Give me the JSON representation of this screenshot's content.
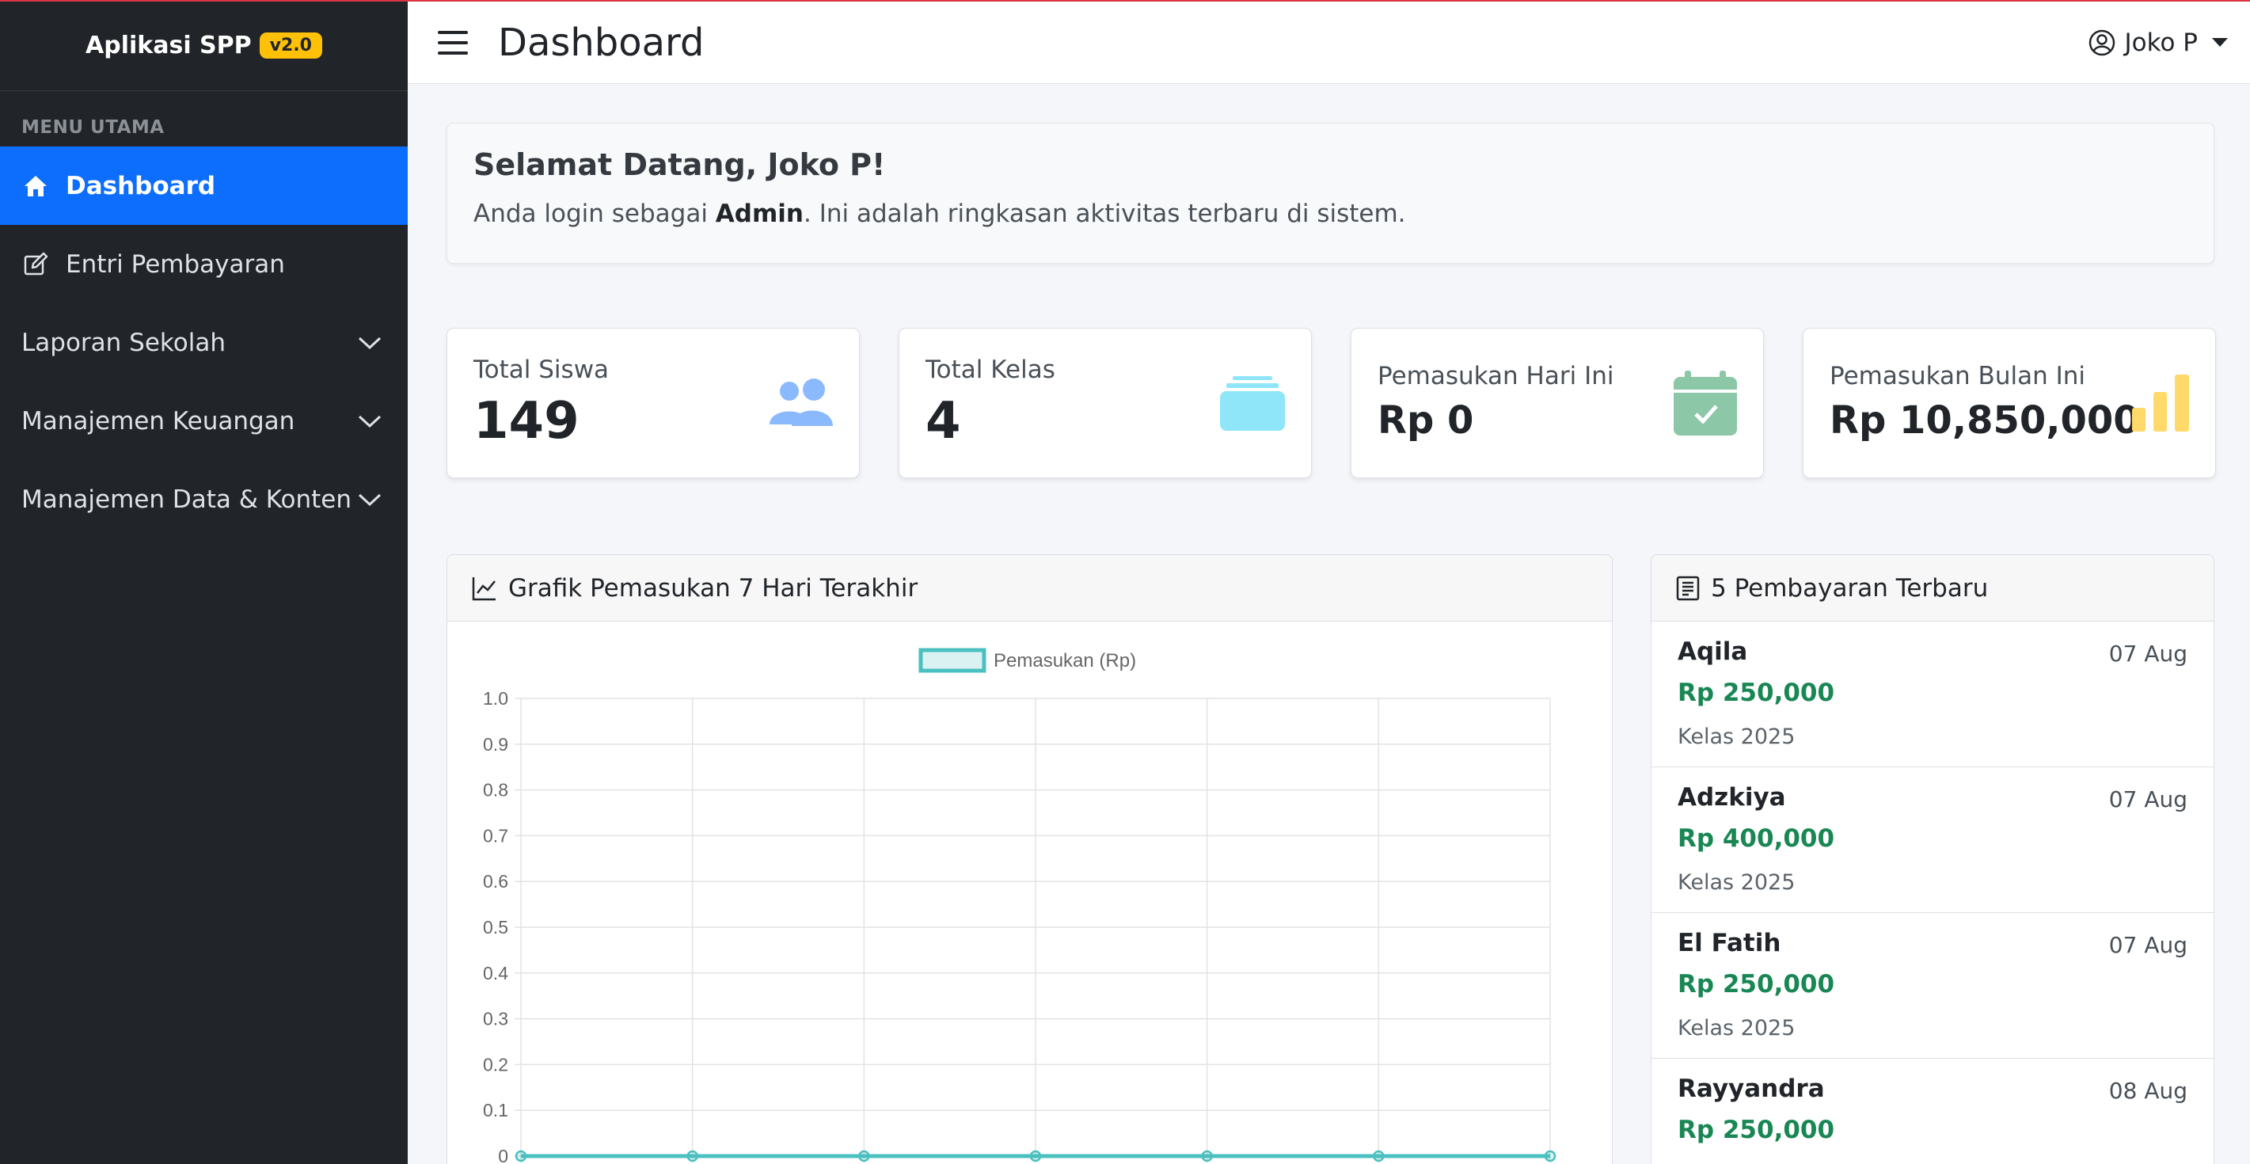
{
  "app": {
    "title": "Aplikasi SPP",
    "version": "v2.0"
  },
  "colors": {
    "primary": "#0d6efd",
    "sidebar": "#212529",
    "success": "#198754",
    "warning": "#ffc107"
  },
  "sidebar": {
    "heading": "MENU UTAMA",
    "items": [
      {
        "label": "Dashboard",
        "icon": "home-icon",
        "active": true
      },
      {
        "label": "Entri Pembayaran",
        "icon": "edit-icon"
      },
      {
        "label": "Laporan Sekolah",
        "icon": "chevron-down-icon"
      },
      {
        "label": "Manajemen Keuangan",
        "icon": "chevron-down-icon"
      },
      {
        "label": "Manajemen Data & Konten",
        "icon": "chevron-down-icon"
      }
    ]
  },
  "header": {
    "title": "Dashboard",
    "user": "Joko P"
  },
  "welcome": {
    "title": "Selamat Datang, Joko P!",
    "text_before": "Anda login sebagai ",
    "role": "Admin",
    "text_after": ". Ini adalah ringkasan aktivitas terbaru di sistem."
  },
  "stats": [
    {
      "label": "Total Siswa",
      "value": "149",
      "icon": "users-icon",
      "color": "#8bb9fe"
    },
    {
      "label": "Total Kelas",
      "value": "4",
      "icon": "layers-icon",
      "color": "#8ee6f8"
    },
    {
      "label": "Pemasukan Hari Ini",
      "value": "Rp 0",
      "icon": "calendar-check-icon",
      "color": "#8cc7a8"
    },
    {
      "label": "Pemasukan Bulan Ini",
      "value": "Rp 10,850,000",
      "icon": "bar-chart-icon",
      "color": "#ffda6a"
    }
  ],
  "chart_panel": {
    "title": "Grafik Pemasukan 7 Hari Terakhir"
  },
  "chart_data": {
    "type": "line",
    "title": "",
    "xlabel": "",
    "ylabel": "",
    "ylim": [
      0,
      1.0
    ],
    "yticks": [
      "1.0",
      "0.9",
      "0.8",
      "0.7",
      "0.6",
      "0.5",
      "0.4",
      "0.3",
      "0.2",
      "0.1",
      "0"
    ],
    "legend_position": "top",
    "series": [
      {
        "name": "Pemasukan (Rp)",
        "values": [
          0,
          0,
          0,
          0,
          0,
          0,
          0
        ],
        "color": "#4bc0c0"
      }
    ]
  },
  "recent_panel": {
    "title": "5 Pembayaran Terbaru",
    "items": [
      {
        "name": "Aqila",
        "date": "07 Aug",
        "amount": "Rp 250,000",
        "class": "Kelas 2025"
      },
      {
        "name": "Adzkiya",
        "date": "07 Aug",
        "amount": "Rp 400,000",
        "class": "Kelas 2025"
      },
      {
        "name": "El Fatih",
        "date": "07 Aug",
        "amount": "Rp 250,000",
        "class": "Kelas 2025"
      },
      {
        "name": "Rayyandra",
        "date": "08 Aug",
        "amount": "Rp 250,000",
        "class": ""
      }
    ]
  }
}
